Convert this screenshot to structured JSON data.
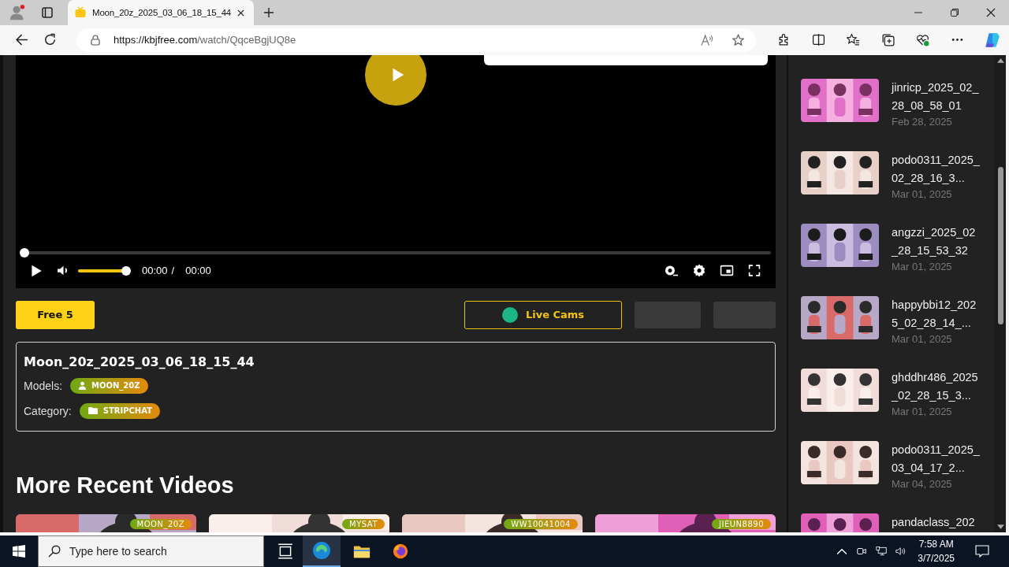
{
  "browser": {
    "tab_title": "Moon_20z_2025_03_06_18_15_44",
    "url_host": "https://kbjfree.com",
    "url_path": "/watch/QqceBgjUQ8e"
  },
  "player": {
    "progress": {
      "level": 0
    },
    "volume": {
      "level": 1
    },
    "time_current": "00:00",
    "time_separator": "/",
    "time_total": "00:00"
  },
  "actions": {
    "free_button": "Free 5",
    "live_cams": "Live Cams"
  },
  "info": {
    "title": "Moon_20z_2025_03_06_18_15_44",
    "models_label": "Models:",
    "model": "MOON_20Z",
    "category_label": "Category:",
    "category": "STRIPCHAT"
  },
  "more_heading": "More Recent Videos",
  "more_videos": [
    {
      "model": "MOON_20Z"
    },
    {
      "model": "MYSAT"
    },
    {
      "model": "WW10041004"
    },
    {
      "model": "JIEUN8890"
    }
  ],
  "sidebar_videos": [
    {
      "title": "jinricp_2025_02_28_08_58_01",
      "date": "Feb 28, 2025"
    },
    {
      "title": "podo0311_2025_02_28_16_3...",
      "date": "Mar 01, 2025"
    },
    {
      "title": "angzzi_2025_02_28_15_53_32",
      "date": "Mar 01, 2025"
    },
    {
      "title": "happybbi12_2025_02_28_14_...",
      "date": "Mar 01, 2025"
    },
    {
      "title": "ghddhr486_2025_02_28_15_3...",
      "date": "Mar 01, 2025"
    },
    {
      "title": "podo0311_2025_03_04_17_2...",
      "date": "Mar 04, 2025"
    },
    {
      "title": "pandaclass_202"
    }
  ],
  "taskbar": {
    "search_placeholder": "Type here to search",
    "time": "7:58 AM",
    "date": "3/7/2025"
  }
}
